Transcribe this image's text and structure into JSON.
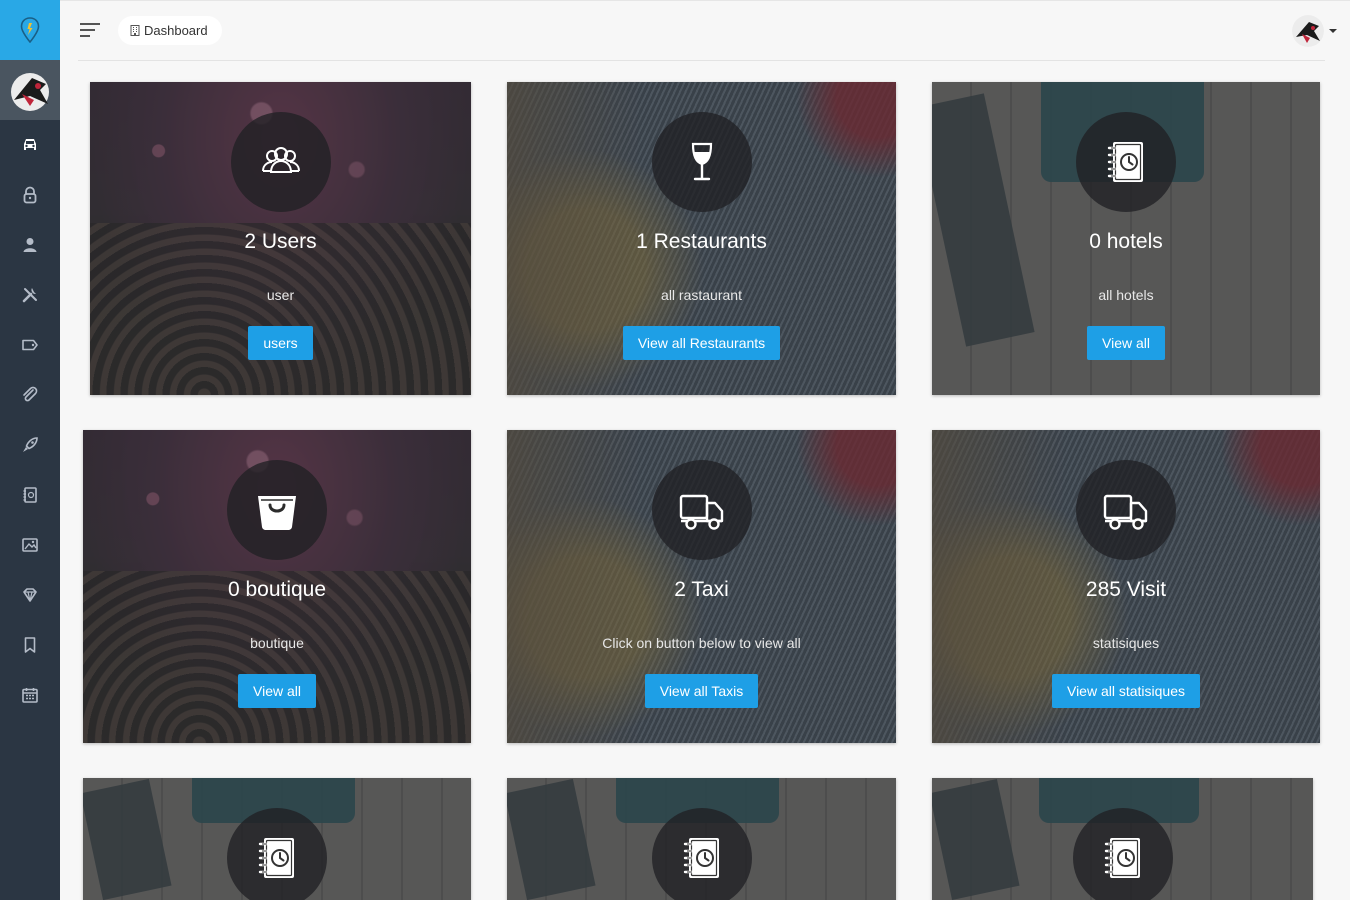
{
  "header": {
    "breadcrumb": "Dashboard"
  },
  "sidebar": {
    "items": [
      {
        "icon": "car-icon",
        "active": true
      },
      {
        "icon": "lock-icon"
      },
      {
        "icon": "user-icon"
      },
      {
        "icon": "tools-icon"
      },
      {
        "icon": "tag-icon"
      },
      {
        "icon": "paperclip-icon"
      },
      {
        "icon": "rocket-icon"
      },
      {
        "icon": "notebook-icon"
      },
      {
        "icon": "image-icon"
      },
      {
        "icon": "diamond-icon"
      },
      {
        "icon": "bookmark-icon"
      },
      {
        "icon": "calendar-icon"
      }
    ]
  },
  "cards": [
    {
      "icon": "users-icon",
      "count": "2 Users",
      "subtitle": "user",
      "button": "users"
    },
    {
      "icon": "wine-glass-icon",
      "count": "1 Restaurants",
      "subtitle": "all rastaurant",
      "button": "View all Restaurants"
    },
    {
      "icon": "notebook-clock-icon",
      "count": "0 hotels",
      "subtitle": "all hotels",
      "button": "View all"
    },
    {
      "icon": "shopping-basket-icon",
      "count": "0 boutique",
      "subtitle": "boutique",
      "button": "View all"
    },
    {
      "icon": "truck-icon",
      "count": "2 Taxi",
      "subtitle": "Click on button below to view all",
      "button": "View all Taxis"
    },
    {
      "icon": "truck-icon",
      "count": "285 Visit",
      "subtitle": "statisiques",
      "button": "View all statisiques"
    },
    {
      "icon": "notebook-clock-icon"
    },
    {
      "icon": "notebook-clock-icon"
    },
    {
      "icon": "notebook-clock-icon"
    }
  ],
  "colors": {
    "accent": "#29a8e6",
    "button": "#1e9fe6",
    "sidebar": "#2b3643"
  }
}
